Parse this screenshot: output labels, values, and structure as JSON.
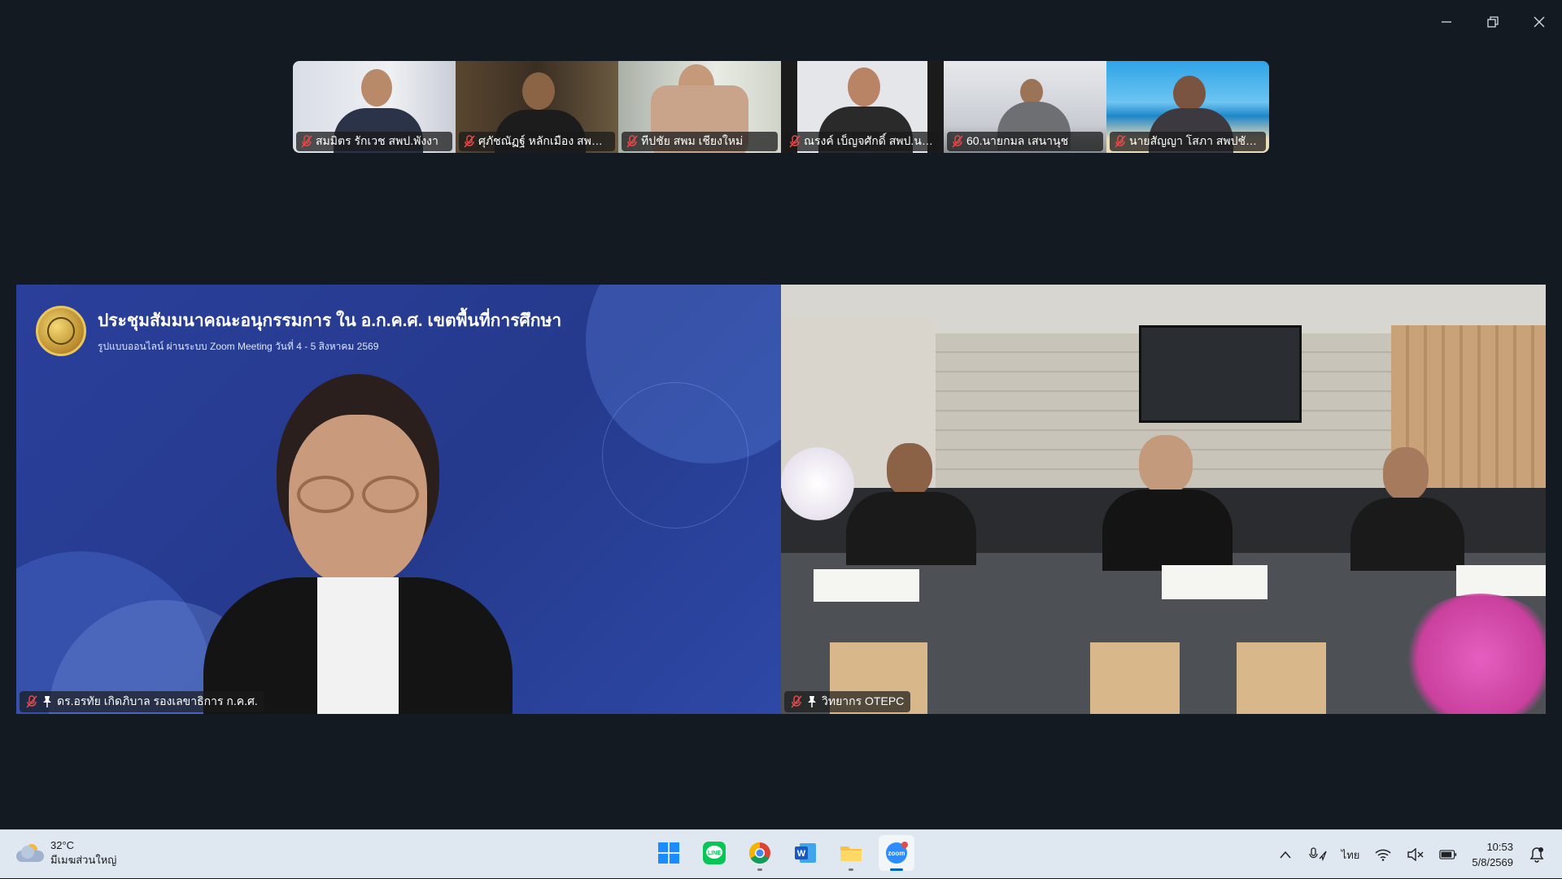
{
  "window_controls": {
    "minimize_icon": "minimize-icon",
    "restore_icon": "restore-icon",
    "close_icon": "close-icon"
  },
  "participants_strip": [
    {
      "name": "สมมิตร รักเวช สพป.พังงา",
      "muted": true
    },
    {
      "name": "ศุภัชณัฏฐ์ หลักเมือง สพม....",
      "muted": true
    },
    {
      "name": "ทีปชัย สพม เชียงใหม่",
      "muted": true
    },
    {
      "name": "ณรงค์ เบ็ญจศักดิ์ สพป.นศ.4",
      "muted": true
    },
    {
      "name": "60.นายกมล เสนานุช",
      "muted": true
    },
    {
      "name": "นายสัญญา โสภา สพปชัย...",
      "muted": true
    }
  ],
  "main_tiles": {
    "left": {
      "banner_title": "ประชุมสัมมนาคณะอนุกรรมการ ใน อ.ก.ค.ศ. เขตพื้นที่การศึกษา",
      "banner_subtitle": "รูปแบบออนไลน์ ผ่านระบบ Zoom Meeting  วันที่ 4 - 5 สิงหาคม 2569",
      "participant_name": "ดร.อรทัย เกิดภิบาล รองเลขาธิการ ก.ค.ศ.",
      "muted": true,
      "pinned": true
    },
    "right": {
      "participant_name": "วิทยากร OTEPC",
      "muted": true,
      "pinned": true
    }
  },
  "taskbar": {
    "weather": {
      "temperature": "32°C",
      "condition": "มีเมฆส่วนใหญ่"
    },
    "apps": [
      "windows-start",
      "line",
      "chrome",
      "word",
      "file-explorer",
      "zoom"
    ],
    "active_app": "zoom",
    "tray": {
      "language": "ไทย"
    },
    "clock": {
      "time": "10:53",
      "date": "5/8/2569"
    }
  },
  "colors": {
    "zoom_bg": "#131a22",
    "left_tile_bg": "#253a8c",
    "taskbar_bg": "#dfe8f1",
    "muted_red": "#e24b4b"
  }
}
